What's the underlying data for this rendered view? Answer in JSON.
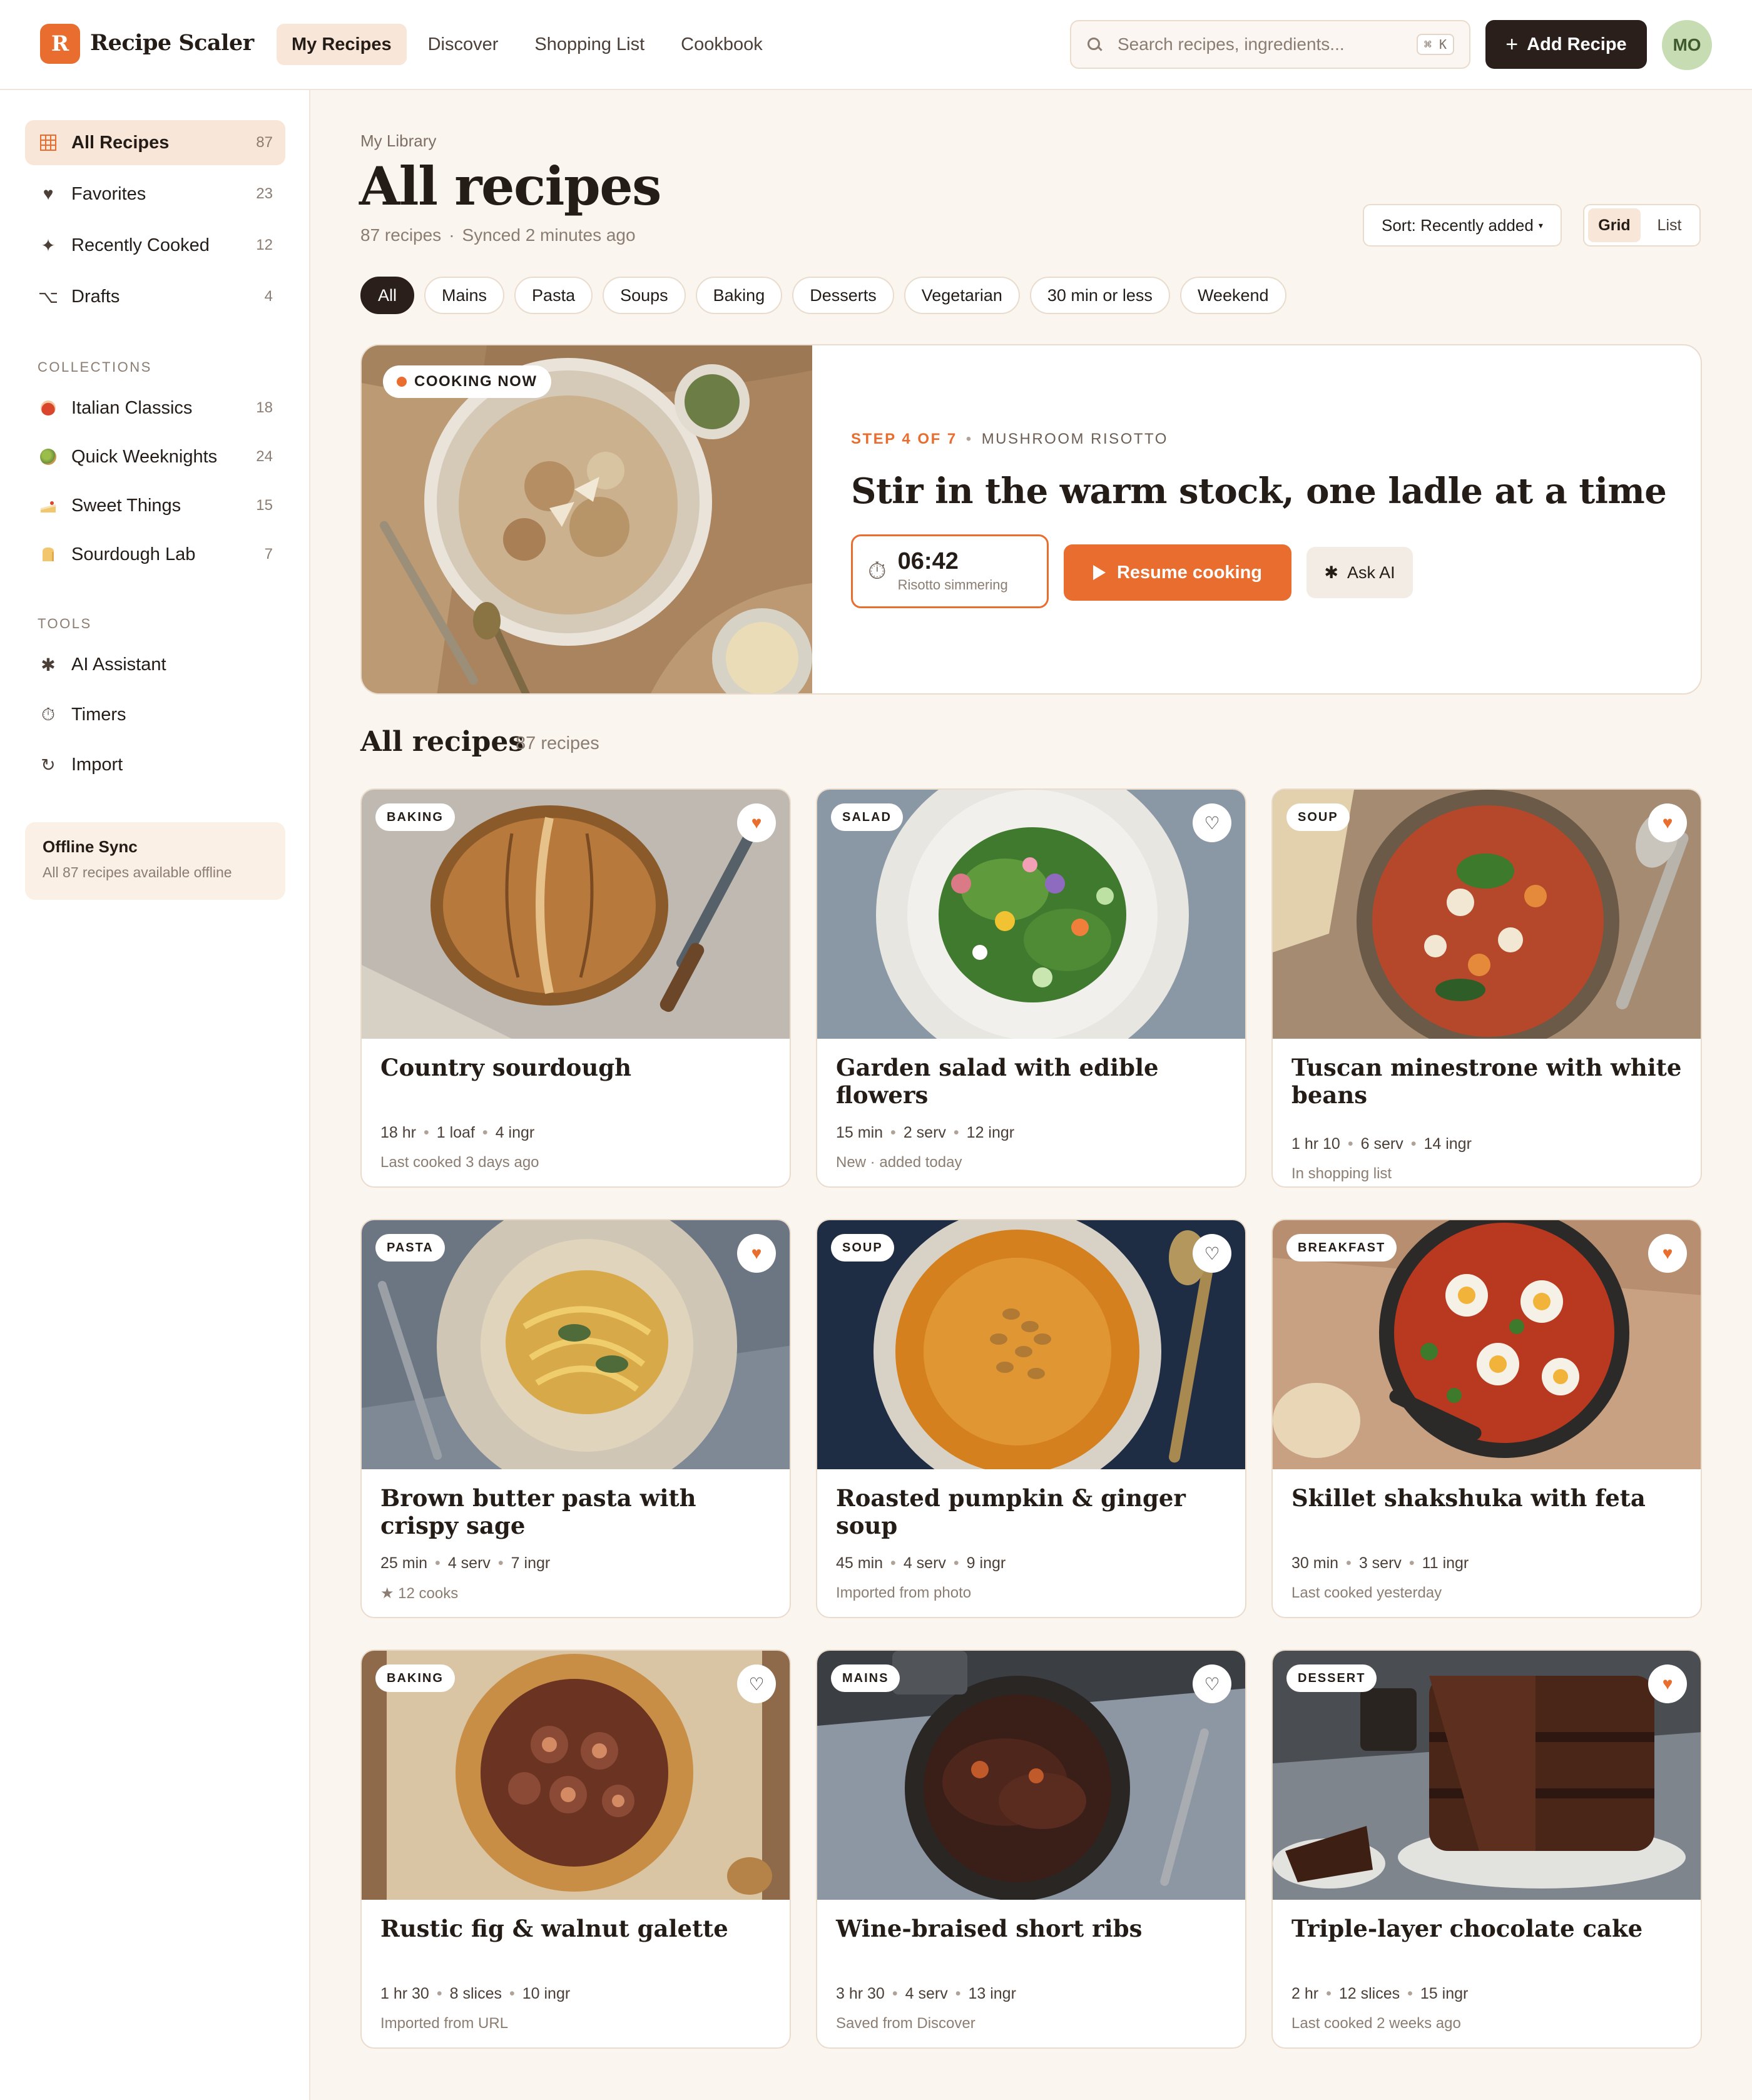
{
  "app": {
    "logo_letter": "R",
    "name": "Recipe Scaler"
  },
  "nav": [
    {
      "label": "My Recipes",
      "active": true
    },
    {
      "label": "Discover"
    },
    {
      "label": "Shopping List"
    },
    {
      "label": "Cookbook"
    }
  ],
  "search": {
    "placeholder": "Search recipes, ingredients...",
    "shortcut": "⌘ K"
  },
  "header_actions": {
    "add_label": "Add Recipe",
    "avatar_initials": "MO"
  },
  "sidebar": {
    "library": [
      {
        "label": "All Recipes",
        "count": "87",
        "icon": "grid-icon",
        "active": true
      },
      {
        "label": "Favorites",
        "count": "23",
        "icon": "heart-icon"
      },
      {
        "label": "Recently Cooked",
        "count": "12",
        "icon": "sparkle-icon"
      },
      {
        "label": "Drafts",
        "count": "4",
        "icon": "drafts-icon"
      }
    ],
    "collections_heading": "COLLECTIONS",
    "collections": [
      {
        "label": "Italian Classics",
        "count": "18",
        "color": "#d9462b"
      },
      {
        "label": "Quick Weeknights",
        "count": "24",
        "color": "#6c8d3b"
      },
      {
        "label": "Sweet Things",
        "count": "15",
        "color": "#e9a83a"
      },
      {
        "label": "Sourdough Lab",
        "count": "7",
        "color": "#d8a04a"
      }
    ],
    "tools_heading": "TOOLS",
    "tools": [
      {
        "label": "AI Assistant",
        "icon": "asterisk-icon"
      },
      {
        "label": "Timers",
        "icon": "stopwatch-icon"
      },
      {
        "label": "Import",
        "icon": "refresh-icon"
      }
    ],
    "offline": {
      "title": "Offline Sync",
      "subtitle": "All 87 recipes available offline"
    }
  },
  "page": {
    "breadcrumb": "My Library",
    "title": "All recipes",
    "count_text": "87 recipes",
    "sync_text": "Synced 2 minutes ago",
    "sort_label": "Sort: Recently added",
    "view_options": [
      {
        "label": "Grid",
        "active": true
      },
      {
        "label": "List"
      }
    ]
  },
  "filters": [
    {
      "label": "All",
      "active": true
    },
    {
      "label": "Mains"
    },
    {
      "label": "Pasta"
    },
    {
      "label": "Soups"
    },
    {
      "label": "Baking"
    },
    {
      "label": "Desserts"
    },
    {
      "label": "Vegetarian"
    },
    {
      "label": "30 min or less"
    },
    {
      "label": "Weekend"
    }
  ],
  "cooking_now": {
    "badge": "COOKING NOW",
    "step": "STEP 4 OF 7",
    "recipe": "MUSHROOM RISOTTO",
    "instruction": "Stir in the warm stock, one ladle at a time",
    "timer_value": "06:42",
    "timer_label": "Risotto simmering",
    "resume_label": "Resume cooking",
    "ask_label": "Ask AI"
  },
  "grid": {
    "title": "All recipes",
    "count": "87 recipes",
    "cards": [
      {
        "tag": "BAKING",
        "title": "Country sourdough",
        "time": "18 hr",
        "yield": "1 loaf",
        "ingredients": "4 ingr",
        "note": "Last cooked 3 days ago",
        "favorite": true,
        "image": "sourdough"
      },
      {
        "tag": "SALAD",
        "title": "Garden salad with edible flowers",
        "time": "15 min",
        "yield": "2 serv",
        "ingredients": "12 ingr",
        "note": "New · added today",
        "favorite": false,
        "image": "salad"
      },
      {
        "tag": "SOUP",
        "title": "Tuscan minestrone with white beans",
        "time": "1 hr 10",
        "yield": "6 serv",
        "ingredients": "14 ingr",
        "note": "In shopping list",
        "favorite": true,
        "image": "minestrone"
      },
      {
        "tag": "PASTA",
        "title": "Brown butter pasta with crispy sage",
        "time": "25 min",
        "yield": "4 serv",
        "ingredients": "7 ingr",
        "note": "★ 12 cooks",
        "favorite": true,
        "image": "pasta"
      },
      {
        "tag": "SOUP",
        "title": "Roasted pumpkin & ginger soup",
        "time": "45 min",
        "yield": "4 serv",
        "ingredients": "9 ingr",
        "note": "Imported from photo",
        "favorite": false,
        "image": "pumpkin"
      },
      {
        "tag": "BREAKFAST",
        "title": "Skillet shakshuka with feta",
        "time": "30 min",
        "yield": "3 serv",
        "ingredients": "11 ingr",
        "note": "Last cooked yesterday",
        "favorite": true,
        "image": "shakshuka"
      },
      {
        "tag": "BAKING",
        "title": "Rustic fig & walnut galette",
        "time": "1 hr 30",
        "yield": "8 slices",
        "ingredients": "10 ingr",
        "note": "Imported from URL",
        "favorite": false,
        "image": "galette"
      },
      {
        "tag": "MAINS",
        "title": "Wine-braised short ribs",
        "time": "3 hr 30",
        "yield": "4 serv",
        "ingredients": "13 ingr",
        "note": "Saved from Discover",
        "favorite": false,
        "image": "shortribs"
      },
      {
        "tag": "DESSERT",
        "title": "Triple-layer chocolate cake",
        "time": "2 hr",
        "yield": "12 slices",
        "ingredients": "15 ingr",
        "note": "Last cooked 2 weeks ago",
        "favorite": true,
        "image": "cake"
      }
    ]
  },
  "colors": {
    "accent": "#e86d2e",
    "dark": "#2a1f1a",
    "background": "#fbf5ef",
    "active_bg": "#f8e7d8"
  }
}
